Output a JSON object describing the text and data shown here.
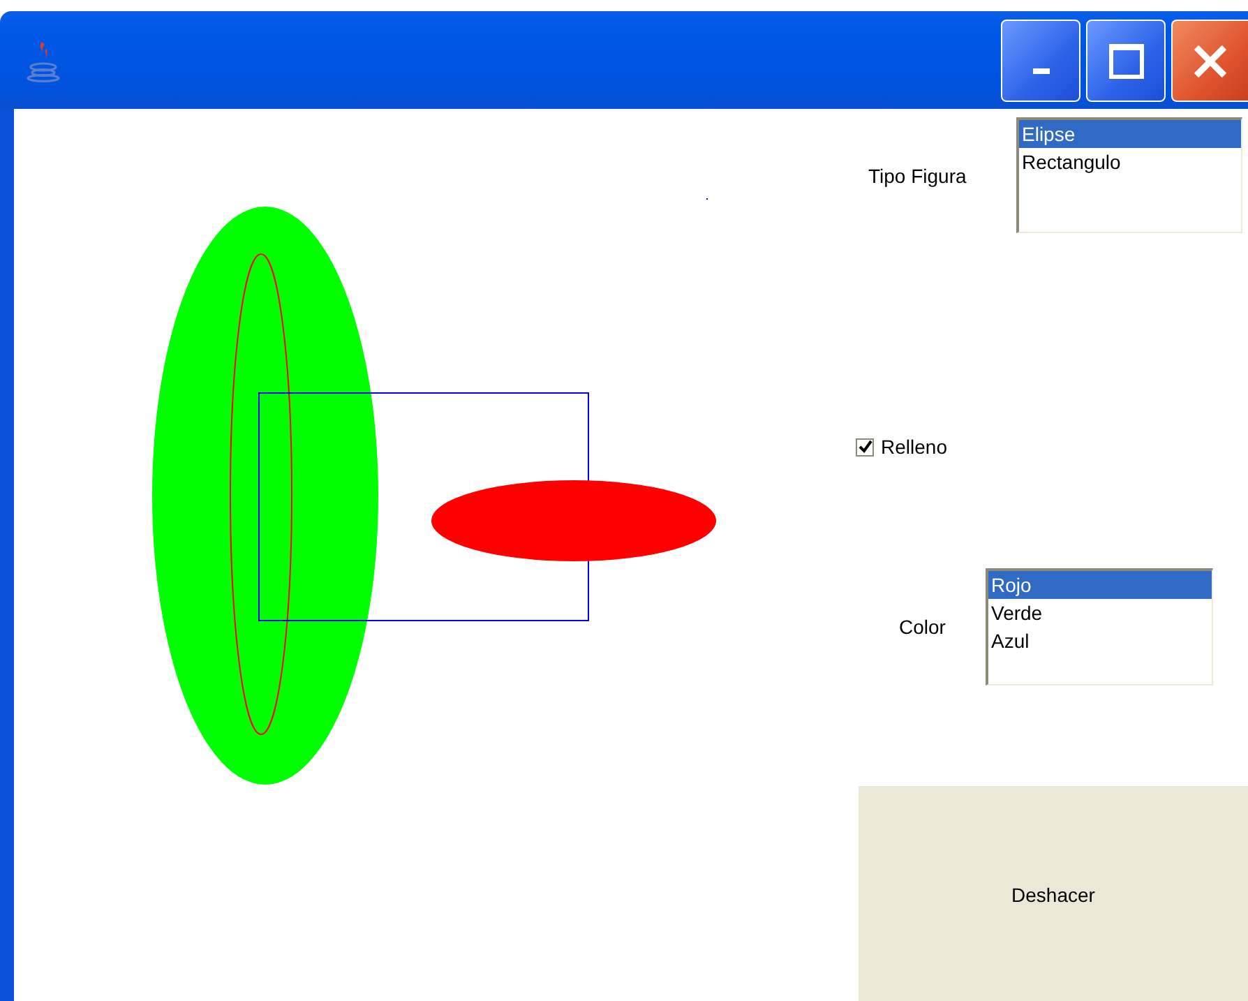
{
  "canvas": {
    "shapes": [
      {
        "kind": "ellipse",
        "filled": true,
        "color": "#00ff00"
      },
      {
        "kind": "ellipse",
        "filled": false,
        "color": "#ff0000"
      },
      {
        "kind": "rect",
        "filled": false,
        "color": "#0000ff"
      },
      {
        "kind": "ellipse",
        "filled": true,
        "color": "#ff0000"
      },
      {
        "kind": "point",
        "filled": true,
        "color": "#0000ff"
      }
    ]
  },
  "figure_type": {
    "label": "Tipo Figura",
    "options": [
      {
        "label": "Elipse",
        "selected": true
      },
      {
        "label": "Rectangulo",
        "selected": false
      }
    ]
  },
  "fill_checkbox": {
    "label": "Relleno",
    "checked": true
  },
  "color": {
    "label": "Color",
    "options": [
      {
        "label": "Rojo",
        "selected": true
      },
      {
        "label": "Verde",
        "selected": false
      },
      {
        "label": "Azul",
        "selected": false
      }
    ]
  },
  "undo_button": {
    "label": "Deshacer"
  }
}
